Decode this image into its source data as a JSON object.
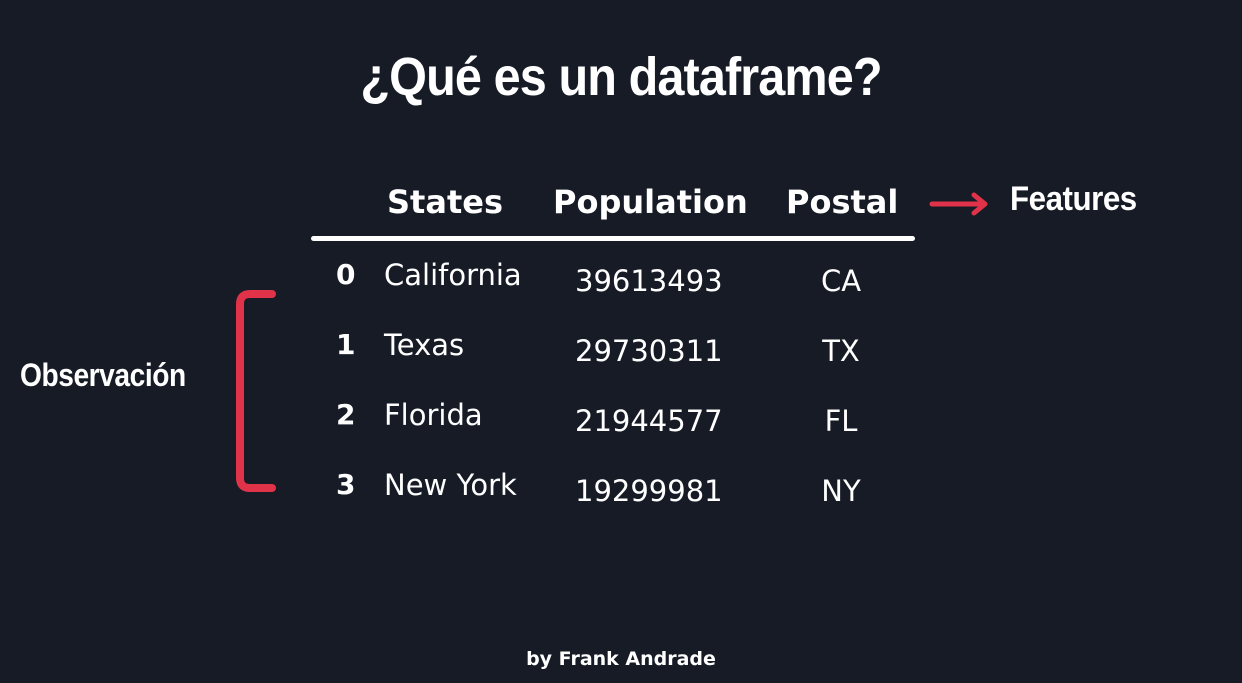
{
  "slide": {
    "title": "¿Qué es un dataframe?",
    "credit": "by Frank Andrade"
  },
  "table": {
    "headers": {
      "states": "States",
      "population": "Population",
      "postal": "Postal"
    },
    "rows": [
      {
        "index": "0",
        "state": "California",
        "population": "39613493",
        "postal": "CA"
      },
      {
        "index": "1",
        "state": "Texas",
        "population": "29730311",
        "postal": "TX"
      },
      {
        "index": "2",
        "state": "Florida",
        "population": "21944577",
        "postal": "FL"
      },
      {
        "index": "3",
        "state": "New York",
        "population": "19299981",
        "postal": "NY"
      }
    ]
  },
  "annotations": {
    "features_label": "Features",
    "observation_label": "Observación",
    "accent_color": "#e0334a",
    "arrow_icon": "arrow-right-icon",
    "bracket_icon": "left-bracket-icon"
  },
  "colors": {
    "background": "#161b26",
    "text": "#ffffff"
  }
}
